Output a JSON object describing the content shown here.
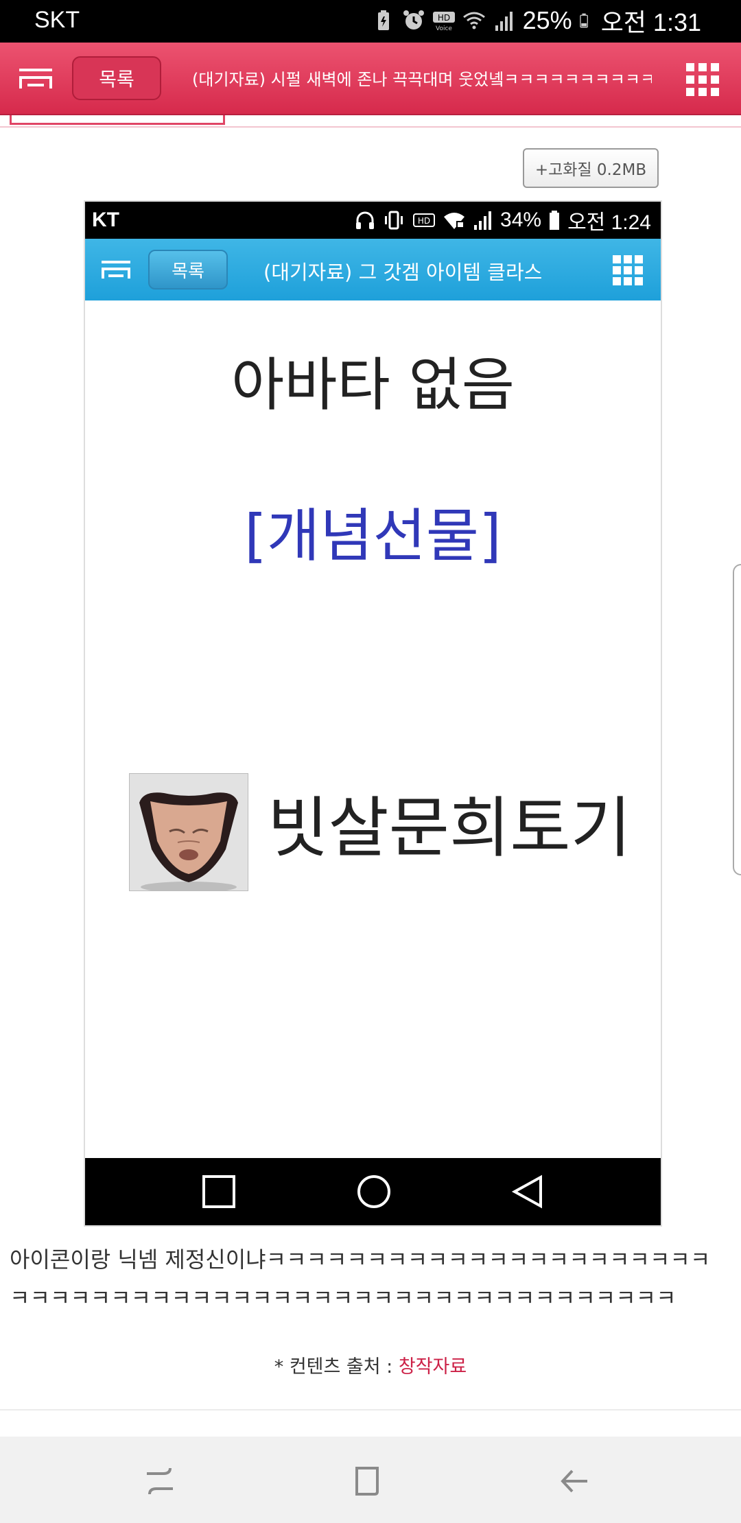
{
  "status_bar": {
    "carrier": "SKT",
    "battery": "25%",
    "time": "오전 1:31",
    "icons": [
      "battery-saver-icon",
      "alarm-icon",
      "hd-voice-icon",
      "wifi-icon",
      "signal-icon",
      "battery-icon"
    ]
  },
  "header": {
    "list_label": "목록",
    "title": "(대기자료) 시펄 새벽에 존나 끅끅대며 웃었녴ㅋㅋㅋㅋㅋㅋㅋㅋㅋㅋㅋ"
  },
  "toolbar": {
    "hq_label": "+고화질 0.2MB"
  },
  "embedded": {
    "carrier": "KT",
    "battery": "34%",
    "time": "오전 1:24",
    "list_label": "목록",
    "title": "(대기자료) 그 갓겜 아이템 클라스",
    "heading": "아바타 없음",
    "gift": "[개념선물]",
    "nickname": "빗살문희토기"
  },
  "post": {
    "text": "아이콘이랑 닉넴 제정신이냐ㅋㅋㅋㅋㅋㅋㅋㅋㅋㅋㅋㅋㅋㅋㅋㅋㅋㅋㅋㅋㅋㅋㅋㅋㅋㅋㅋㅋㅋㅋㅋㅋㅋㅋㅋㅋㅋㅋㅋㅋㅋㅋㅋㅋㅋㅋㅋㅋㅋㅋㅋㅋㅋㅋㅋ",
    "source_prefix": "* 컨텐츠 출처 : ",
    "source_link": "창작자료"
  },
  "colors": {
    "header_pink": "#d62a4c",
    "embedded_blue": "#1ea0da",
    "gift_blue": "#3038b8",
    "link_red": "#cc2147"
  }
}
